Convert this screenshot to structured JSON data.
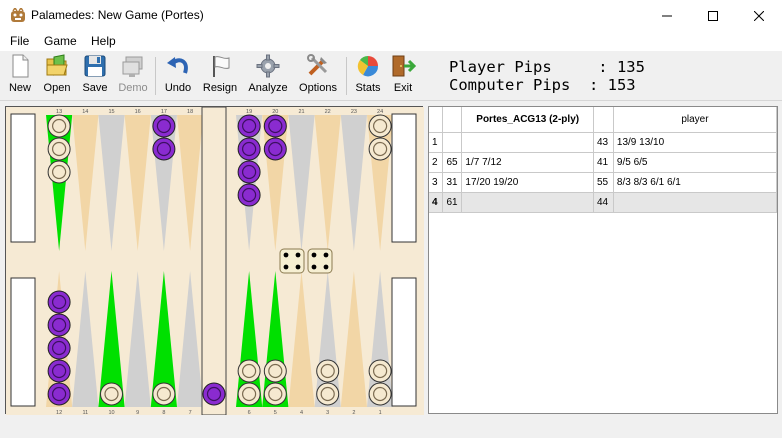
{
  "window": {
    "title": "Palamedes: New Game  (Portes)"
  },
  "menu": [
    "File",
    "Game",
    "Help"
  ],
  "toolbar": {
    "buttons": [
      {
        "label": "New",
        "icon": "new-document-icon",
        "enabled": true
      },
      {
        "label": "Open",
        "icon": "open-folder-icon",
        "enabled": true
      },
      {
        "label": "Save",
        "icon": "floppy-disk-icon",
        "enabled": true
      },
      {
        "label": "Demo",
        "icon": "demo-screens-icon",
        "enabled": false
      },
      {
        "label": "Undo",
        "icon": "undo-arrow-icon",
        "enabled": true
      },
      {
        "label": "Resign",
        "icon": "white-flag-icon",
        "enabled": true
      },
      {
        "label": "Analyze",
        "icon": "gear-icon",
        "enabled": true
      },
      {
        "label": "Options",
        "icon": "tools-icon",
        "enabled": true
      },
      {
        "label": "Stats",
        "icon": "pie-chart-icon",
        "enabled": true
      },
      {
        "label": "Exit",
        "icon": "exit-door-icon",
        "enabled": true
      }
    ],
    "player_pips": "Player Pips     : 135",
    "computer_pips": "Computer Pips  : 153"
  },
  "board": {
    "top_point_numbers": [
      "13",
      "14",
      "15",
      "16",
      "17",
      "18",
      "19",
      "20",
      "21",
      "22",
      "23",
      "24"
    ],
    "bottom_point_numbers": [
      "12",
      "11",
      "10",
      "9",
      "8",
      "7",
      "6",
      "5",
      "4",
      "3",
      "2",
      "1"
    ],
    "dice": [
      4,
      4
    ],
    "colors": {
      "board": "#f6ead4",
      "green_point": "#00e000",
      "grey_point": "#d0d0d0",
      "tan_point": "#f2d6a6",
      "purple_checker": "#8a2bd0",
      "white_checker": "#f5e9d0"
    },
    "checkers": {
      "top": {
        "13": {
          "color": "white",
          "count": 3
        },
        "17": {
          "color": "purple",
          "count": 2
        },
        "19": {
          "color": "purple",
          "count": 4
        },
        "20": {
          "color": "purple",
          "count": 2
        },
        "24": {
          "color": "white",
          "count": 2
        }
      },
      "bottom": {
        "12": {
          "color": "purple",
          "count": 5
        },
        "10": {
          "color": "white",
          "count": 1
        },
        "8": {
          "color": "white",
          "count": 1
        },
        "6": {
          "color": "white",
          "count": 2
        },
        "5": {
          "color": "white",
          "count": 2
        },
        "3": {
          "color": "white",
          "count": 2
        },
        "1": {
          "color": "white",
          "count": 2
        }
      },
      "bar": {
        "color": "purple",
        "count": 1
      }
    }
  },
  "moves": {
    "headers": [
      "",
      "",
      "Portes_ACG13 (2-ply)",
      "",
      "player"
    ],
    "rows": [
      {
        "n": "1",
        "c_roll": "",
        "c_move": "",
        "p_roll": "43",
        "p_move": "13/9 13/10"
      },
      {
        "n": "2",
        "c_roll": "65",
        "c_move": "1/7 7/12",
        "p_roll": "41",
        "p_move": "9/5 6/5"
      },
      {
        "n": "3",
        "c_roll": "31",
        "c_move": "17/20 19/20",
        "p_roll": "55",
        "p_move": "8/3 8/3 6/1 6/1"
      },
      {
        "n": "4",
        "c_roll": "61",
        "c_move": "",
        "p_roll": "44",
        "p_move": ""
      }
    ]
  }
}
